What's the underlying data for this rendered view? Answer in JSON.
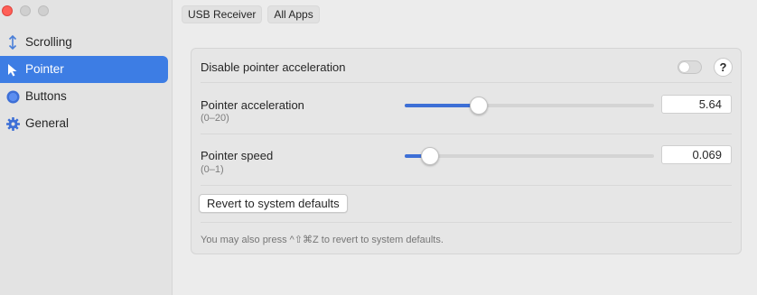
{
  "sidebar": {
    "items": [
      {
        "label": "Scrolling",
        "icon": "arrows-updown-icon"
      },
      {
        "label": "Pointer",
        "icon": "pointer-arrow-icon"
      },
      {
        "label": "Buttons",
        "icon": "circle-button-icon"
      },
      {
        "label": "General",
        "icon": "gear-icon"
      }
    ],
    "active": "Pointer"
  },
  "toolbar": {
    "device_label": "USB Receiver",
    "apps_label": "All Apps"
  },
  "pointer": {
    "disable_accel_label": "Disable pointer acceleration",
    "disable_accel_on": false,
    "help_label": "?",
    "accel": {
      "label": "Pointer acceleration",
      "range": "(0–20)",
      "value": "5.64",
      "min": 0,
      "max": 20
    },
    "speed": {
      "label": "Pointer speed",
      "range": "(0–1)",
      "value": "0.069",
      "min": 0,
      "max": 1
    },
    "revert_label": "Revert to system defaults",
    "note": "You may also press ^⇧⌘Z to revert to system defaults."
  },
  "colors": {
    "accent": "#3d7de4",
    "slider_fill": "#3d6fd6",
    "close": "#fe5f57"
  }
}
